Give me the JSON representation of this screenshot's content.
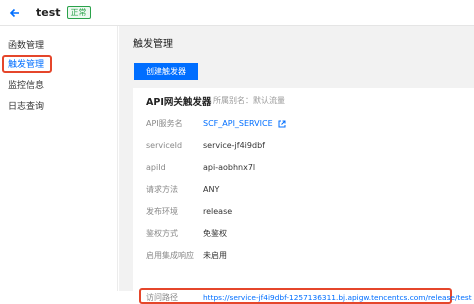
{
  "header": {
    "title": "test",
    "status_badge": "正常"
  },
  "sidebar": {
    "items": [
      {
        "label": "函数管理"
      },
      {
        "label": "触发管理"
      },
      {
        "label": "监控信息"
      },
      {
        "label": "日志查询"
      }
    ],
    "active_index": 1
  },
  "main": {
    "title": "触发管理",
    "create_button": "创建触发器"
  },
  "trigger": {
    "title": "API网关触发器",
    "subtitle": "所属别名：默认流量",
    "rows": [
      {
        "label": "API服务名",
        "value": "SCF_API_SERVICE"
      },
      {
        "label": "serviceId",
        "value": "service-jf4i9dbf"
      },
      {
        "label": "apiId",
        "value": "api-aobhnx7l"
      },
      {
        "label": "请求方法",
        "value": "ANY"
      },
      {
        "label": "发布环境",
        "value": "release"
      },
      {
        "label": "鉴权方式",
        "value": "免鉴权"
      },
      {
        "label": "启用集成响应",
        "value": "未启用"
      },
      {
        "label": "访问路径",
        "value": "https://service-jf4i9dbf-1257136311.bj.apigw.tencentcs.com/release/test"
      }
    ]
  },
  "colors": {
    "accent": "#006eff",
    "highlight": "#e5462b",
    "status": "#2aa24a"
  },
  "icons": {
    "back": "arrow-left-icon",
    "external": "external-link-icon",
    "copy": "copy-icon"
  }
}
